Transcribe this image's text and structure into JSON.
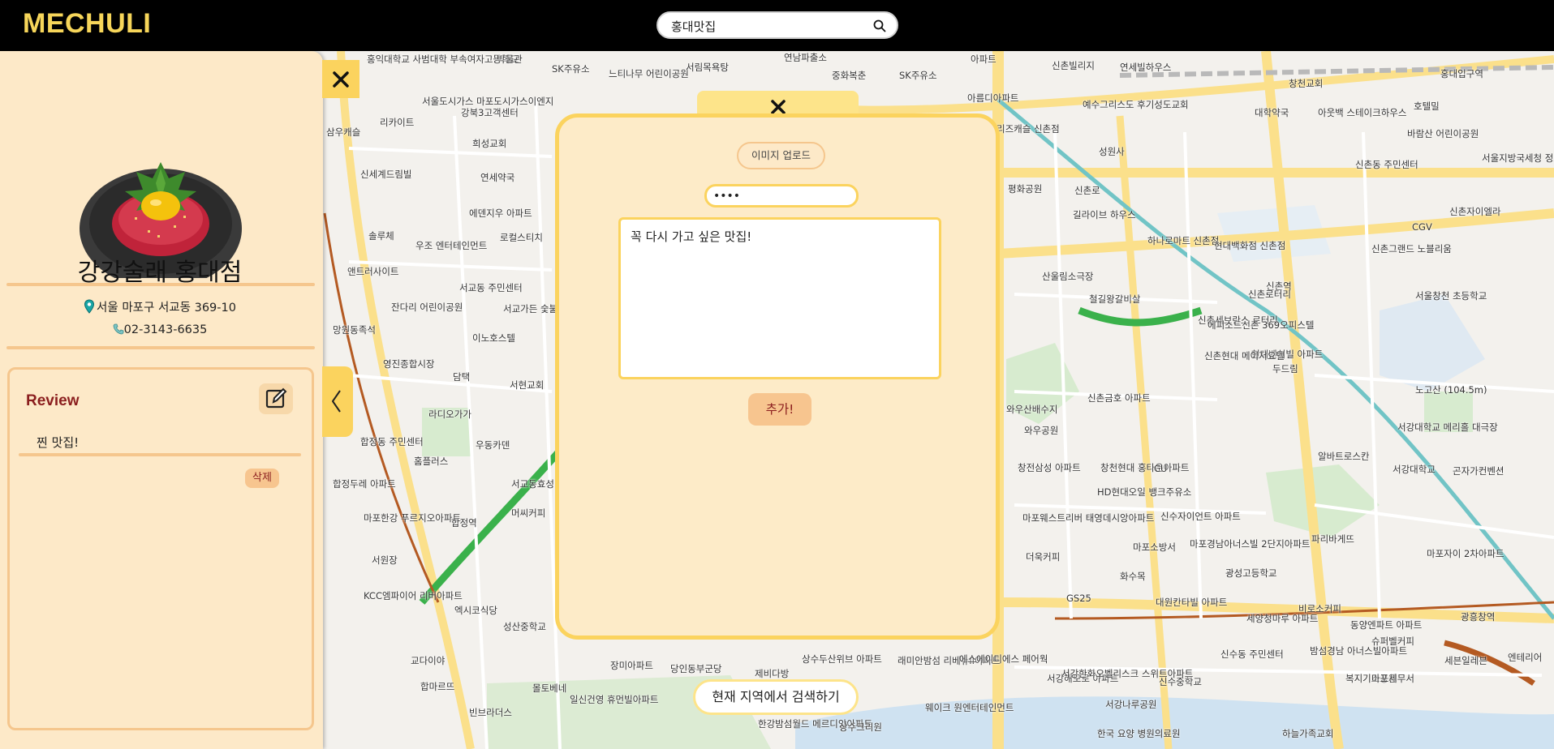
{
  "app": {
    "logo": "MECHULI"
  },
  "search": {
    "value": "홍대맛집",
    "icon": "search-icon"
  },
  "restaurant": {
    "name": "강강술래 홍대점",
    "address": "서울 마포구 서교동 369-10",
    "phone": "02-3143-6635"
  },
  "review": {
    "title": "Review",
    "items": [
      {
        "text": "찐 맛집!",
        "delete_label": "삭제"
      }
    ]
  },
  "modal": {
    "upload_label": "이미지 업로드",
    "password_value": "••••",
    "textarea_value": "꼭 다시 가고 싶은 맛집!",
    "add_label": "추가!"
  },
  "map": {
    "search_here_label": "현재 지역에서 검색하기",
    "labels": [
      "홍익대학교 사범대학 부속여자고등학교",
      "박물관",
      "SK주유소",
      "느티나무 어린이공원",
      "서림목욕탕",
      "연남파출소",
      "중화복춘",
      "SK주유소",
      "아파트",
      "신촌빌리지",
      "연세빌하우스",
      "창천교회",
      "홍대입구역",
      "서울도시가스 마포도시가스이엔지",
      "강북3고객센터",
      "대학약국",
      "호텔밀",
      "아웃백 스테이크하우스",
      "바람산 어린이공원",
      "삼우캐슬",
      "리카이트",
      "희성교회",
      "신세계드림빌",
      "연세약국",
      "에덴지우 아파트",
      "우조 엔터테인먼트",
      "로컬스티치",
      "솔루체",
      "앤트러사이트",
      "서교동 주민센터",
      "잔다리 어린이공원",
      "서교가든 숯불갈비",
      "이노호스텔",
      "망원동족석",
      "영진종합시장",
      "담택",
      "라디오가가",
      "서현교회",
      "우동카덴",
      "합정동 주민센터",
      "홈플러스",
      "합정두레 아파트",
      "서교동효성 타워아파트",
      "마포한강 푸르지오아파트",
      "머씨커피",
      "합정역",
      "서원장",
      "KCC엠파이어 리버아파트",
      "엑시코식당",
      "성산중학교",
      "교다이야",
      "합마르뜨",
      "몰토베네",
      "빈브라더스",
      "일신건영 휴먼빌아파트",
      "장미아파트",
      "당인동부군당",
      "상수두산위브 아파트",
      "래미안밤섬 리베뉴II아파트",
      "제비다방",
      "한강밤섬월드 메르디앙아파트",
      "상수크리원",
      "웨이크 원엔터테인먼트",
      "에스에이디에스 페어웍",
      "예수그리스도 후기성도교회",
      "성원사",
      "리즈캐슬 신촌점",
      "신촌로",
      "평화공원",
      "길라이브 하우스",
      "하나로마트 신촌점",
      "산울림소극장",
      "철길왕갈비살",
      "두드림",
      "신촌세브란스 로터리",
      "현대벤처빌 아파트",
      "창천현대 홍타운아파트",
      "와우산배수지",
      "와우공원",
      "신촌금호 아파트",
      "창전삼성 아파트",
      "HD현대오일 뱅크주유소",
      "마포웨스트리버 태영데시앙아파트",
      "신수자이언트 아파트",
      "마포소방서",
      "마포경남아너스빌 2단지아파트",
      "광성고등학교",
      "더욱커피",
      "화수목",
      "GS25",
      "대원칸타빌 아파트",
      "세양청마루 아파트",
      "밤섬경남 아너스빌아파트",
      "신수동 주민센터",
      "슈퍼벨커피",
      "복지기소공원",
      "서강해모로 아파트",
      "신수중학교",
      "서강한화오벨리스크 스위트아파트",
      "서강나루공원",
      "신촌역",
      "현대백화점 신촌점",
      "신촌현대 메이저요텔",
      "에피소드신촌 369오피스텔",
      "서강대학교 메리홀 대극장",
      "노고산 (104.5m)",
      "알바트로스칸",
      "서강대학교",
      "곤자가컨벤션",
      "CGV",
      "신촌자이엘라",
      "신촌그랜드 노블리움",
      "신촌동 주민센터",
      "서울지방국세청 정보화센터",
      "서울창천 초등학교",
      "광흥창역",
      "마포자이 2차아파트",
      "동양엔파트 아파트",
      "파리바게뜨",
      "비로소커피",
      "마포세무서",
      "하늘가족교회",
      "한국 요양 병원의료원",
      "엔테리어",
      "CU",
      "세븐일레븐",
      "아름디아파트",
      "신촌로터리"
    ]
  }
}
